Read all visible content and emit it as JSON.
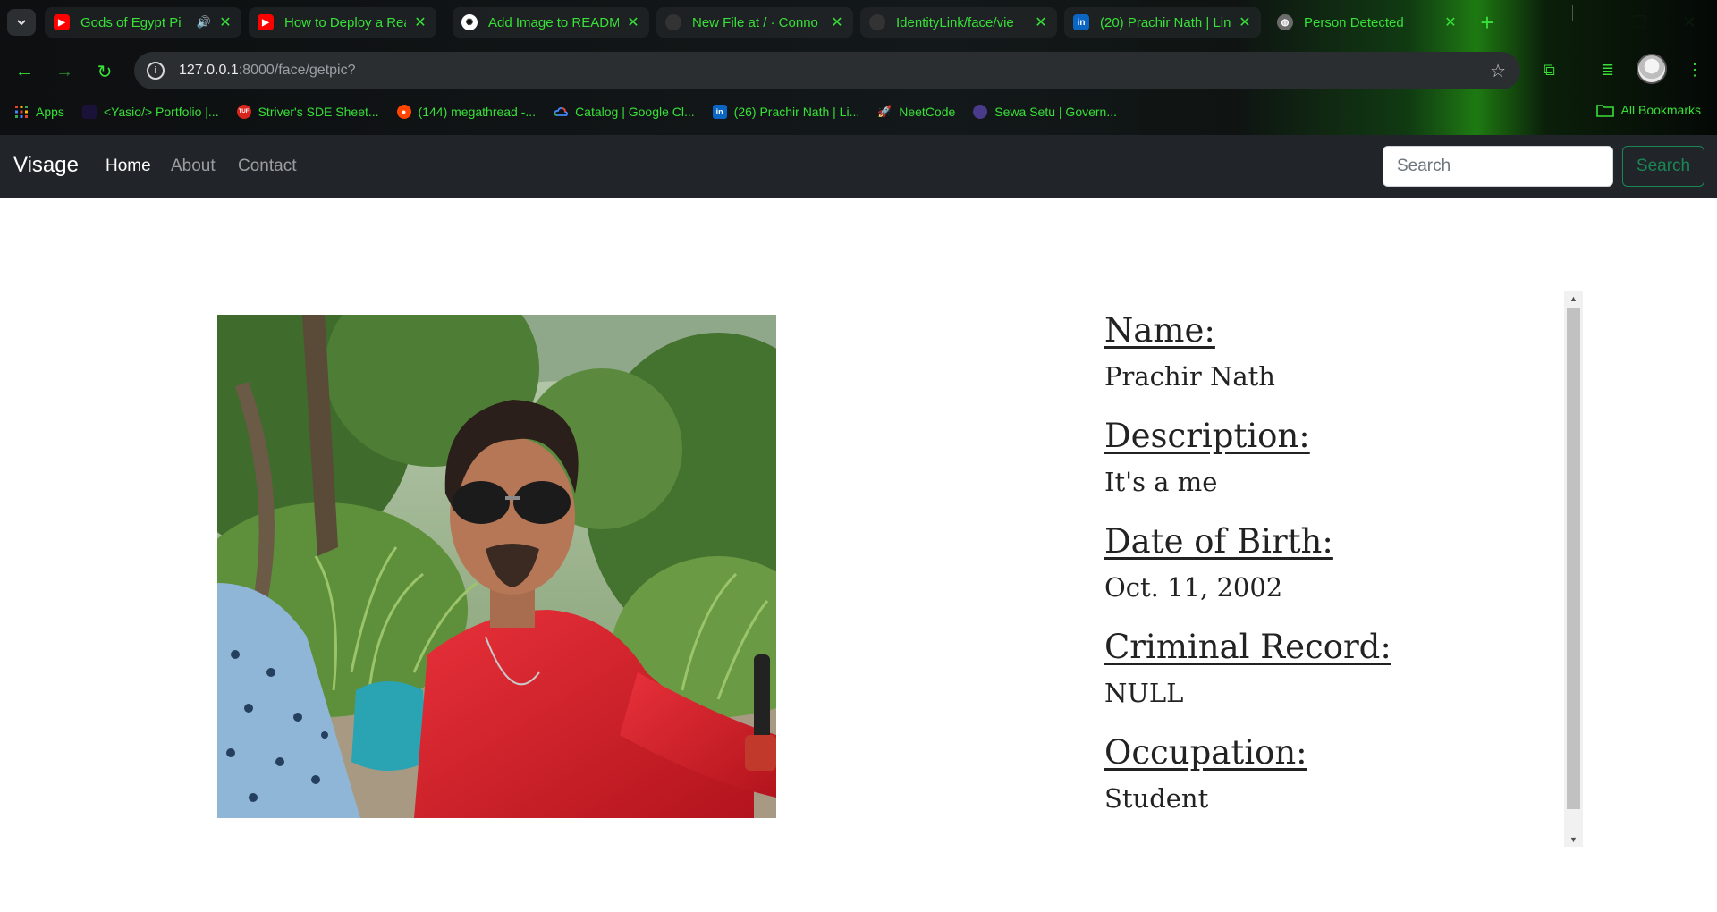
{
  "browser": {
    "tabs": [
      {
        "title": "Gods of Egypt Pi",
        "favicon": "youtube-icon",
        "audio": true
      },
      {
        "title": "How to Deploy a Rea",
        "favicon": "youtube-icon"
      },
      {
        "title": "Add Image to READM",
        "favicon": "openai-icon"
      },
      {
        "title": "New File at / · Conno",
        "favicon": "github-icon"
      },
      {
        "title": "IdentityLink/face/vie",
        "favicon": "github-icon"
      },
      {
        "title": "(20) Prachir Nath | Lin",
        "favicon": "linkedin-icon"
      },
      {
        "title": "Person Detected",
        "favicon": "globe-icon",
        "active": true
      }
    ],
    "address": {
      "host": "127.0.0.1",
      "path": ":8000/face/getpic?"
    },
    "bookmarks": [
      {
        "label": "Apps",
        "favicon": "apps-grid-icon"
      },
      {
        "label": "<Yasio/> Portfolio |...",
        "favicon": "portfolio-icon"
      },
      {
        "label": "Striver's SDE Sheet...",
        "favicon": "tuf-icon"
      },
      {
        "label": "(144) megathread -...",
        "favicon": "reddit-icon"
      },
      {
        "label": "Catalog | Google Cl...",
        "favicon": "google-cloud-icon"
      },
      {
        "label": "(26) Prachir Nath | Li...",
        "favicon": "linkedin-icon"
      },
      {
        "label": "NeetCode",
        "favicon": "rocket-icon"
      },
      {
        "label": "Sewa Setu | Govern...",
        "favicon": "emblem-icon"
      }
    ],
    "all_bookmarks": "All Bookmarks",
    "accent_color": "#38e038"
  },
  "app": {
    "brand": "Visage",
    "nav": {
      "home": "Home",
      "about": "About",
      "contact": "Contact"
    },
    "search": {
      "placeholder": "Search",
      "button": "Search"
    },
    "button_color": "#198754"
  },
  "person": {
    "fields": [
      {
        "label": "Name:",
        "value": "Prachir Nath"
      },
      {
        "label": "Description:",
        "value": "It's a me"
      },
      {
        "label": "Date of Birth:",
        "value": "Oct. 11, 2002"
      },
      {
        "label": "Criminal Record:",
        "value": "NULL"
      },
      {
        "label": "Occupation:",
        "value": "Student"
      }
    ]
  }
}
